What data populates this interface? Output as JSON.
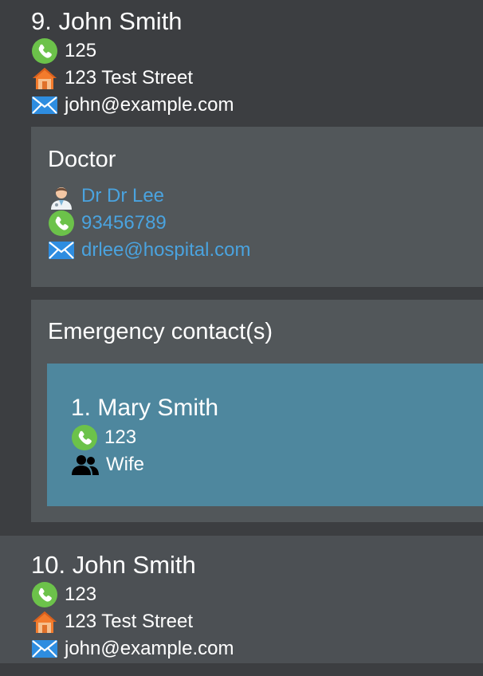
{
  "persons": [
    {
      "index_name": "9. John Smith",
      "phone": "125",
      "address": "123 Test Street",
      "email": "john@example.com",
      "icons": {
        "phone": "phone-icon",
        "address": "house-icon",
        "email": "mail-icon"
      },
      "doctor": {
        "section_title": "Doctor",
        "name": "Dr Dr Lee",
        "phone": "93456789",
        "email": "drlee@hospital.com",
        "icons": {
          "name": "doctor-avatar-icon",
          "phone": "phone-icon",
          "email": "mail-icon"
        }
      },
      "emergency": {
        "section_title": "Emergency contact(s)",
        "contacts": [
          {
            "index_name": "1. Mary Smith",
            "phone": "123",
            "relationship": "Wife",
            "icons": {
              "phone": "phone-icon",
              "relationship": "people-icon"
            }
          }
        ]
      }
    },
    {
      "index_name": "10. John Smith",
      "phone": "123",
      "address": "123 Test Street",
      "email": "john@example.com",
      "icons": {
        "phone": "phone-icon",
        "address": "house-icon",
        "email": "mail-icon"
      }
    }
  ],
  "colors": {
    "background": "#3c3e41",
    "panel": "#52575a",
    "selected_card": "#4c5054",
    "emergency_box": "#4e879e",
    "link": "#4aa3df",
    "phone_icon": "#6cc24a",
    "house_roof": "#f37b2c"
  }
}
